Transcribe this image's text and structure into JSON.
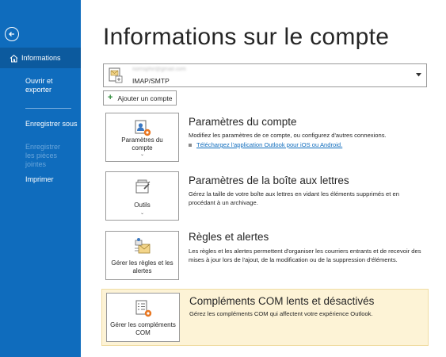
{
  "sidebar": {
    "back_icon": "back-arrow-icon",
    "items": [
      {
        "label": "Informations",
        "active": true,
        "icon": "home-icon"
      },
      {
        "label": "Ouvrir et exporter"
      },
      {
        "label": "Enregistrer sous"
      },
      {
        "label": "Enregistrer les pièces jointes",
        "disabled": true
      },
      {
        "label": "Imprimer"
      }
    ],
    "background": "#0f6cbd",
    "active_background": "#0c5a9e"
  },
  "main": {
    "title": "Informations sur le compte",
    "account": {
      "email": "nomsphir@gmail.com",
      "type": "IMAP/SMTP"
    },
    "add_account_label": "Ajouter un compte",
    "sections": [
      {
        "tile_label": "Paramètres du compte",
        "title": "Paramètres du compte",
        "description": "Modifiez les paramètres de ce compte, ou configurez d'autres connexions.",
        "link": "Téléchargez l'application Outlook pour iOS ou Android."
      },
      {
        "tile_label": "Outils",
        "title": "Paramètres de la boîte aux lettres",
        "description": "Gérez la taille de votre boîte aux lettres en vidant les éléments supprimés et en procédant à un archivage."
      },
      {
        "tile_label": "Gérer les règles et les alertes",
        "title": "Règles et alertes",
        "description": "Les règles et les alertes permettent d'organiser les courriers entrants et de recevoir des mises à jour lors de l'ajout, de la modification ou de la suppression d'éléments."
      },
      {
        "tile_label": "Gérer les compléments COM",
        "title": "Compléments COM lents et désactivés",
        "description": "Gérez les compléments COM qui affectent votre expérience Outlook.",
        "highlight_color": "#fdf3d6"
      }
    ]
  }
}
